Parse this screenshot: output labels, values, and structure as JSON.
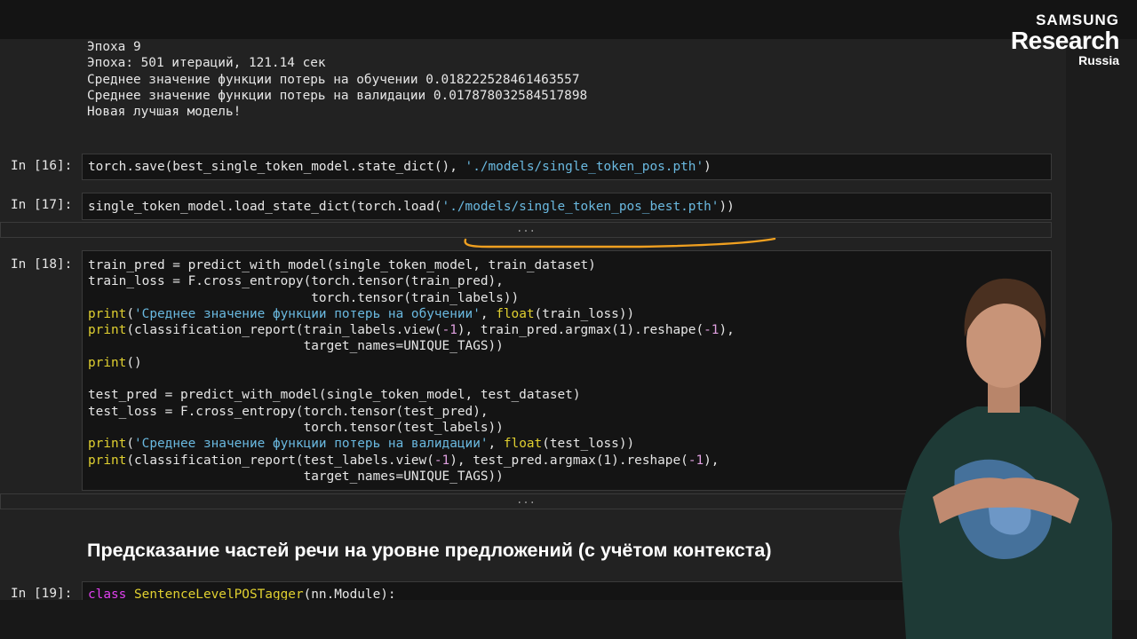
{
  "brand": {
    "line1": "SAMSUNG",
    "line2": "Research",
    "line3": "Russia"
  },
  "output_lines": [
    "Эпоха 9",
    "Эпоха: 501 итераций, 121.14 сек",
    "Среднее значение функции потерь на обучении 0.018222528461463557",
    "Среднее значение функции потерь на валидации 0.017878032584517898",
    "Новая лучшая модель!"
  ],
  "cells": {
    "c16": {
      "prompt": "In [16]:",
      "p1": "torch.save(best_single_token_model.state_dict(), ",
      "s1": "'./models/single_token_pos.pth'",
      "p2": ")"
    },
    "c17": {
      "prompt": "In [17]:",
      "p1": "single_token_model.load_state_dict(torch.load(",
      "s1": "'./models/single_token_pos_best.pth'",
      "p2": "))"
    },
    "c18": {
      "prompt": "In [18]:",
      "l1": "train_pred = predict_with_model(single_token_model, train_dataset)",
      "l2": "train_loss = F.cross_entropy(torch.tensor(train_pred),",
      "l3": "                             torch.tensor(train_labels))",
      "l4_fn": "print",
      "l4_a": "(",
      "l4_s": "'Среднее значение функции потерь на обучении'",
      "l4_b": ", ",
      "l4_fn2": "float",
      "l4_c": "(train_loss))",
      "l5_fn": "print",
      "l5_a": "(classification_report(train_labels.view(",
      "l5_n1": "-1",
      "l5_b": "), train_pred.argmax(1).reshape(",
      "l5_n2": "-1",
      "l5_c": "),",
      "l6": "                            target_names=UNIQUE_TAGS))",
      "l7_fn": "print",
      "l7_a": "()",
      "l8": "test_pred = predict_with_model(single_token_model, test_dataset)",
      "l9": "test_loss = F.cross_entropy(torch.tensor(test_pred),",
      "l10": "                            torch.tensor(test_labels))",
      "l11_fn": "print",
      "l11_a": "(",
      "l11_s": "'Среднее значение функции потерь на валидации'",
      "l11_b": ", ",
      "l11_fn2": "float",
      "l11_c": "(test_loss))",
      "l12_fn": "print",
      "l12_a": "(classification_report(test_labels.view(",
      "l12_n1": "-1",
      "l12_b": "), test_pred.argmax(1).reshape(",
      "l12_n2": "-1",
      "l12_c": "),",
      "l13": "                            target_names=UNIQUE_TAGS))"
    },
    "c19": {
      "prompt": "In [19]:",
      "kw": "class",
      "name": "SentenceLevelPOSTagger",
      "rest": "(nn.Module):"
    }
  },
  "collapsed": "...",
  "section_heading": "Предсказание частей речи на уровне предложений (с учётом контекста)",
  "colors": {
    "string": "#6ab9e0",
    "keyword": "#e040ef",
    "builtin": "#e0d030",
    "annotation": "#f0a020"
  }
}
